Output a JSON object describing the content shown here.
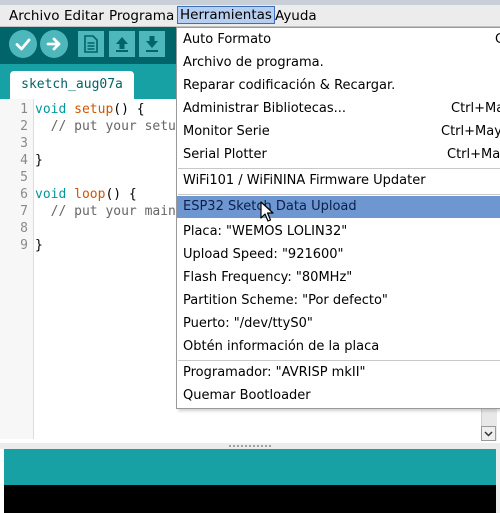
{
  "menubar": {
    "items": [
      {
        "label": "Archivo"
      },
      {
        "label": "Editar"
      },
      {
        "label": "Programa"
      },
      {
        "label": "Herramientas"
      },
      {
        "label": "Ayuda"
      }
    ]
  },
  "editor": {
    "tab_label": "sketch_aug07a",
    "line_numbers": [
      "1",
      "2",
      "3",
      "4",
      "5",
      "6",
      "7",
      "8",
      "9"
    ],
    "code": {
      "l1_kw": "void",
      "l1_fn": "setup",
      "l1_rest": "() {",
      "l2": "  // put your setu",
      "l4": "}",
      "l6_kw": "void",
      "l6_fn": "loop",
      "l6_rest": "() {",
      "l7": "  // put your main",
      "l9": "}"
    }
  },
  "dropdown": {
    "items": [
      {
        "label": "Auto Formato",
        "shortcut": "C"
      },
      {
        "label": "Archivo de programa.",
        "shortcut": ""
      },
      {
        "label": "Reparar codificación & Recargar.",
        "shortcut": ""
      },
      {
        "label": "Administrar Bibliotecas...",
        "shortcut": "Ctrl+Ma"
      },
      {
        "label": "Monitor Serie",
        "shortcut": "Ctrl+May"
      },
      {
        "label": "Serial Plotter",
        "shortcut": "Ctrl+Ma"
      },
      {
        "label": "WiFi101 / WiFiNINA Firmware Updater",
        "shortcut": ""
      },
      {
        "label": "ESP32 Sketch Data Upload",
        "shortcut": ""
      },
      {
        "label": "Placa: \"WEMOS LOLIN32\"",
        "shortcut": ""
      },
      {
        "label": "Upload Speed: \"921600\"",
        "shortcut": ""
      },
      {
        "label": "Flash Frequency: \"80MHz\"",
        "shortcut": ""
      },
      {
        "label": "Partition Scheme: \"Por defecto\"",
        "shortcut": ""
      },
      {
        "label": "Puerto: \"/dev/ttyS0\"",
        "shortcut": ""
      },
      {
        "label": "Obtén información de la placa",
        "shortcut": ""
      },
      {
        "label": "Programador: \"AVRISP mkII\"",
        "shortcut": ""
      },
      {
        "label": "Quemar Bootloader",
        "shortcut": ""
      }
    ]
  },
  "colors": {
    "toolbar": "#006468",
    "tab_strip": "#17a1a5",
    "button": "#4db7bb",
    "menu_highlight": "#6e97d2",
    "console": "#000000"
  },
  "icons": {
    "verify": "check-icon",
    "upload": "arrow-right-icon",
    "new": "new-file-icon",
    "open": "open-arrow-up-icon",
    "save": "save-arrow-down-icon"
  }
}
